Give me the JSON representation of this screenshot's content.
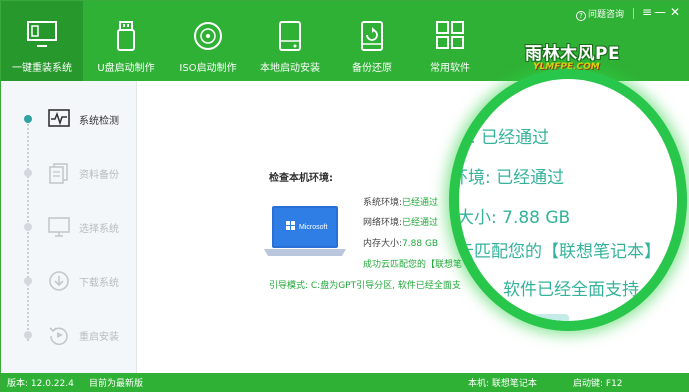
{
  "toolbar": {
    "items": [
      {
        "label": "一键重装系统",
        "icon": "monitor-icon",
        "active": true
      },
      {
        "label": "U盘启动制作",
        "icon": "usb-drive-icon",
        "active": false
      },
      {
        "label": "ISO启动制作",
        "icon": "disc-icon",
        "active": false
      },
      {
        "label": "本地启动安装",
        "icon": "hard-drive-icon",
        "active": false
      },
      {
        "label": "备份还原",
        "icon": "backup-icon",
        "active": false
      },
      {
        "label": "常用软件",
        "icon": "apps-grid-icon",
        "active": false
      }
    ]
  },
  "logo": {
    "title": "雨林木风PE",
    "subtitle": "YLMFPE.COM"
  },
  "window_controls": {
    "help_label": "问题咨询",
    "help_icon": "?",
    "menu": "≡",
    "minimize": "—",
    "close": "✕"
  },
  "sidebar": {
    "steps": [
      {
        "label": "系统检测",
        "icon": "pulse-monitor-icon",
        "active": true
      },
      {
        "label": "资料备份",
        "icon": "document-copy-icon",
        "active": false
      },
      {
        "label": "选择系统",
        "icon": "monitor-select-icon",
        "active": false
      },
      {
        "label": "下载系统",
        "icon": "download-icon",
        "active": false
      },
      {
        "label": "重启安装",
        "icon": "restart-icon",
        "active": false
      }
    ]
  },
  "check": {
    "title": "检查本机环境:",
    "laptop_brand": "Microsoft",
    "rows": [
      {
        "key": "系统环境:",
        "value": "已经通过"
      },
      {
        "key": "网络环境:",
        "value": "已经通过"
      },
      {
        "key": "内存大小:",
        "value": "7.88 GB"
      }
    ],
    "match_text": "成功云匹配您的【联想笔",
    "guide_text": "引导模式: C:盘为GPT引导分区, 软件已经全面支"
  },
  "magnifier": {
    "lines": [
      "境: 已经通过",
      "环境: 已经通过",
      "大小: 7.88 GB",
      "云匹配您的【联想笔记本】",
      "软件已经全面支持"
    ]
  },
  "status": {
    "version": "版本: 12.0.22.4",
    "update": "目前为最新版",
    "machine": "本机: 联想笔记本",
    "shortcut": "启动键: F12"
  }
}
